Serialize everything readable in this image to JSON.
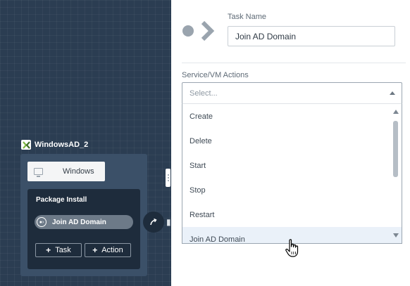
{
  "canvas": {
    "service": {
      "name": "WindowsAD_2",
      "substrate_label": "Windows",
      "package": {
        "title": "Package Install",
        "task_label": "Join AD Domain",
        "add_task_label": "Task",
        "add_action_label": "Action"
      }
    },
    "icons": {
      "service_logo": "nutanix-x-logo",
      "substrate": "vm-monitor-icon",
      "task": "task-target-icon",
      "flow": "flow-arrow-icon",
      "trash": "trash-icon"
    },
    "colors": {
      "background": "#2b3d52",
      "card": "#3b5068",
      "package_box": "#1e2c3c",
      "task_pill": "#6d7a88"
    }
  },
  "panel": {
    "header_icon": "task-arrow-icon",
    "task_name_label": "Task Name",
    "task_name_value": "Join AD Domain",
    "actions_label": "Service/VM Actions",
    "select_placeholder": "Select...",
    "options": [
      "Create",
      "Delete",
      "Start",
      "Stop",
      "Restart",
      "Join AD Domain"
    ],
    "hovered_option": "Join AD Domain",
    "colors": {
      "hover": "#eaf1f9",
      "icon": "#9aa4ae"
    }
  }
}
